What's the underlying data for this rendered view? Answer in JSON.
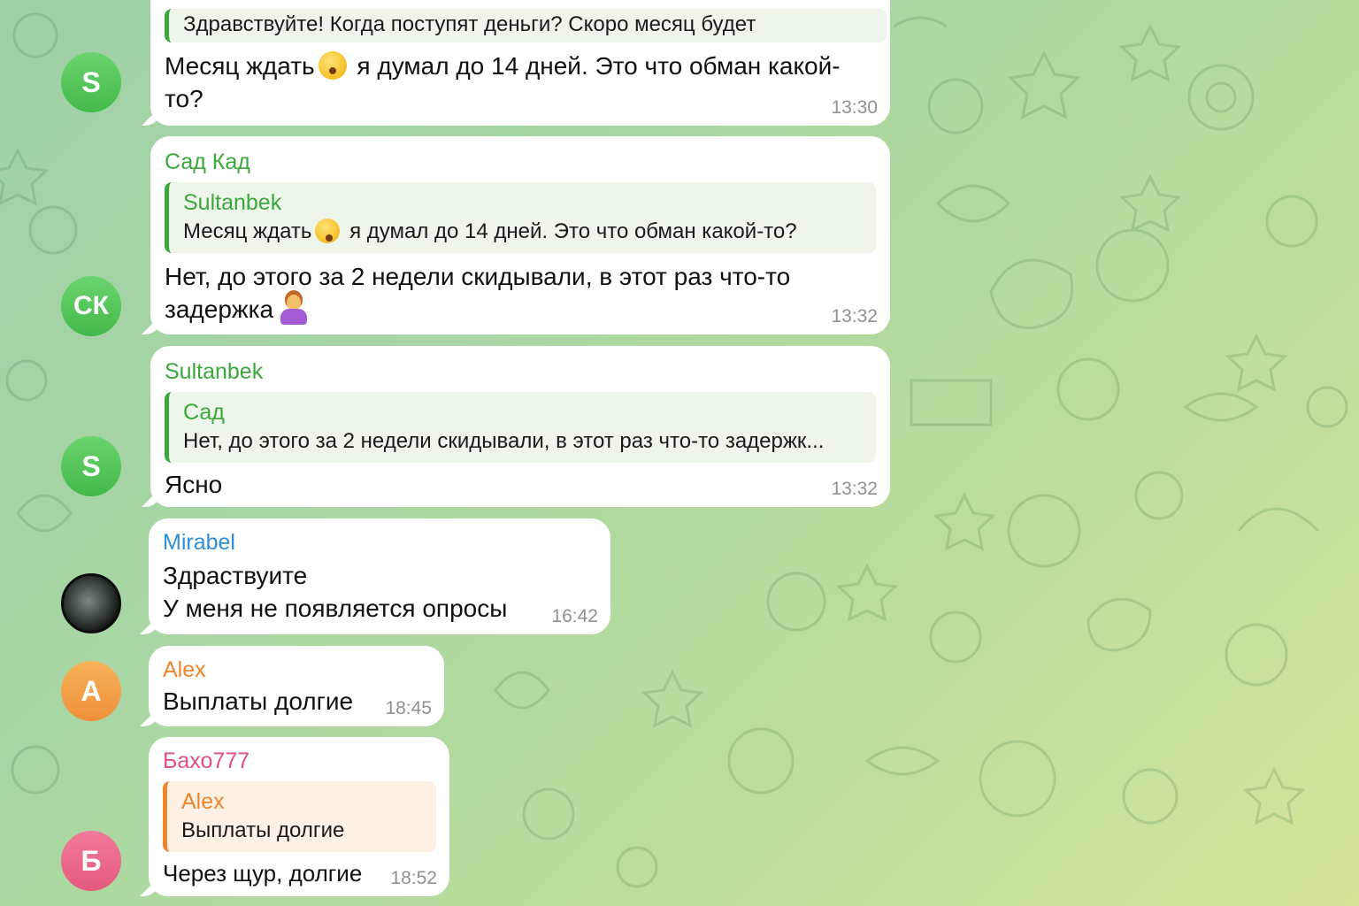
{
  "messages": [
    {
      "avatar_initials": "S",
      "reply_text": "Здравствуйте! Когда поступят деньги? Скоро месяц будет",
      "text_part1": "Месяц ждать",
      "text_part2": " я думал до 14 дней. Это что обман какой-",
      "text_line2": "то?",
      "time": "13:30"
    },
    {
      "avatar_initials": "СК",
      "sender": "Сад Кад",
      "reply_name": "Sultanbek",
      "reply_text_part1": "Месяц ждать",
      "reply_text_part2": " я думал до 14 дней. Это что обман какой-то?",
      "text_line1": "Нет, до этого за 2 недели скидывали, в этот раз что-то",
      "text_line2": "задержка",
      "time": "13:32"
    },
    {
      "avatar_initials": "S",
      "sender": "Sultanbek",
      "reply_name": "Сад",
      "reply_text": "Нет, до этого за 2 недели скидывали, в этот раз что-то задержк...",
      "text": "Ясно",
      "time": "13:32"
    },
    {
      "sender": "Mirabel",
      "text_line1": "Здраствуите",
      "text_line2": "У меня не появляется опросы",
      "time": "16:42"
    },
    {
      "avatar_initials": "A",
      "sender": "Alex",
      "text": "Выплаты долгие",
      "time": "18:45"
    },
    {
      "avatar_initials": "Б",
      "sender": "Бахо777",
      "reply_name": "Alex",
      "reply_text": "Выплаты долгие",
      "text": "Через щур, долгие",
      "time": "18:52"
    }
  ],
  "icons": {
    "shush_emoji": "shushing-face-emoji",
    "shrug_emoji": "woman-shrugging-emoji"
  },
  "colors": {
    "green_name": "#3aa83a",
    "blue_name": "#2d8fd9",
    "orange_name": "#f0852b",
    "pink_name": "#e05080",
    "time": "#8a9590"
  }
}
